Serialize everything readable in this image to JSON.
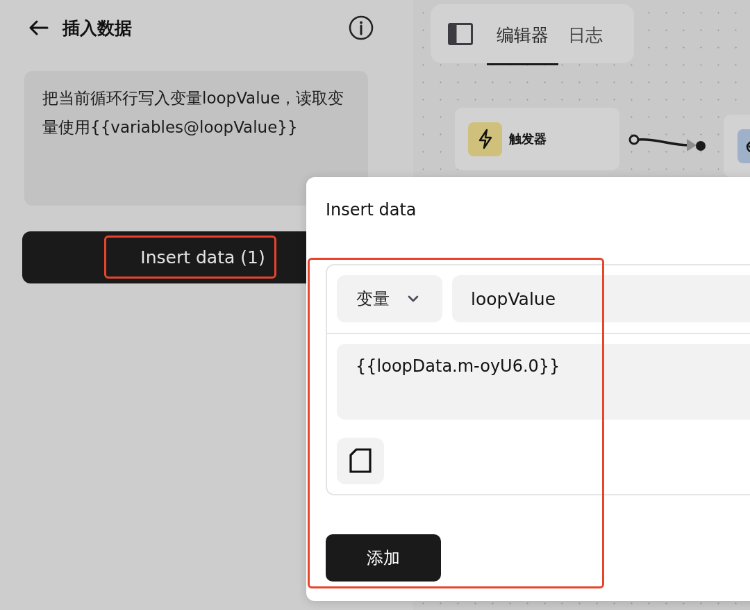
{
  "side_panel": {
    "title": "插入数据",
    "description": "把当前循环行写入变量loopValue，读取变量使用{{variables@loopValue}}",
    "insert_button": {
      "label": "Insert data (1)",
      "highlighted": true
    }
  },
  "editor": {
    "tabs": [
      {
        "label": "编辑器",
        "selected": true
      },
      {
        "label": "日志",
        "selected": false
      }
    ],
    "nodes": [
      {
        "kind": "trigger",
        "label": "触发器"
      },
      {
        "kind": "step"
      }
    ]
  },
  "dialog": {
    "title": "Insert data",
    "highlighted": true,
    "rows": [
      {
        "type_select": "变量",
        "name": "loopValue",
        "value": "{{loopData.m-oyU6.0}}"
      }
    ],
    "add_button": "添加"
  }
}
